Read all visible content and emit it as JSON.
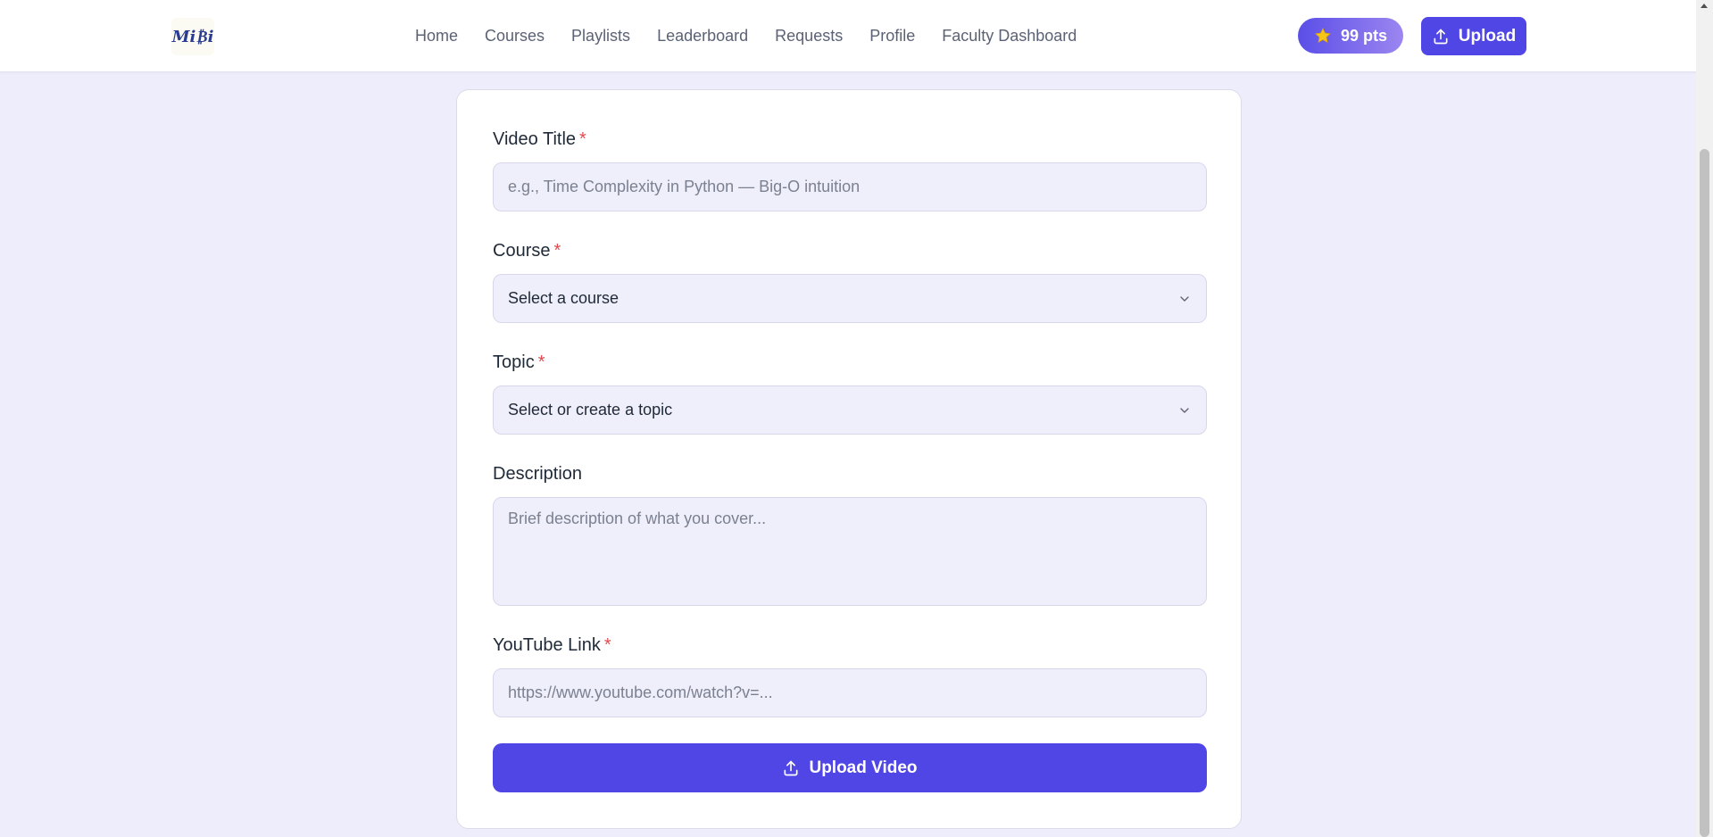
{
  "logo": {
    "text": "Mi₿i"
  },
  "nav": {
    "items": [
      "Home",
      "Courses",
      "Playlists",
      "Leaderboard",
      "Requests",
      "Profile",
      "Faculty Dashboard"
    ]
  },
  "points": {
    "label": "99 pts"
  },
  "header_upload": {
    "label": "Upload"
  },
  "form": {
    "title": {
      "label": "Video Title",
      "required": "*",
      "placeholder": "e.g., Time Complexity in Python — Big-O intuition"
    },
    "course": {
      "label": "Course",
      "required": "*",
      "value": "Select a course"
    },
    "topic": {
      "label": "Topic",
      "required": "*",
      "value": "Select or create a topic"
    },
    "description": {
      "label": "Description",
      "placeholder": "Brief description of what you cover..."
    },
    "youtube": {
      "label": "YouTube Link",
      "required": "*",
      "placeholder": "https://www.youtube.com/watch?v=..."
    },
    "submit_label": "Upload Video"
  },
  "colors": {
    "accent": "#4f46e5",
    "background": "#eeedfb",
    "field_bg": "#efeefb",
    "required": "#e5484d"
  },
  "icons": {
    "points": "star-icon",
    "upload": "upload-icon",
    "dropdown": "chevron-down-icon"
  }
}
